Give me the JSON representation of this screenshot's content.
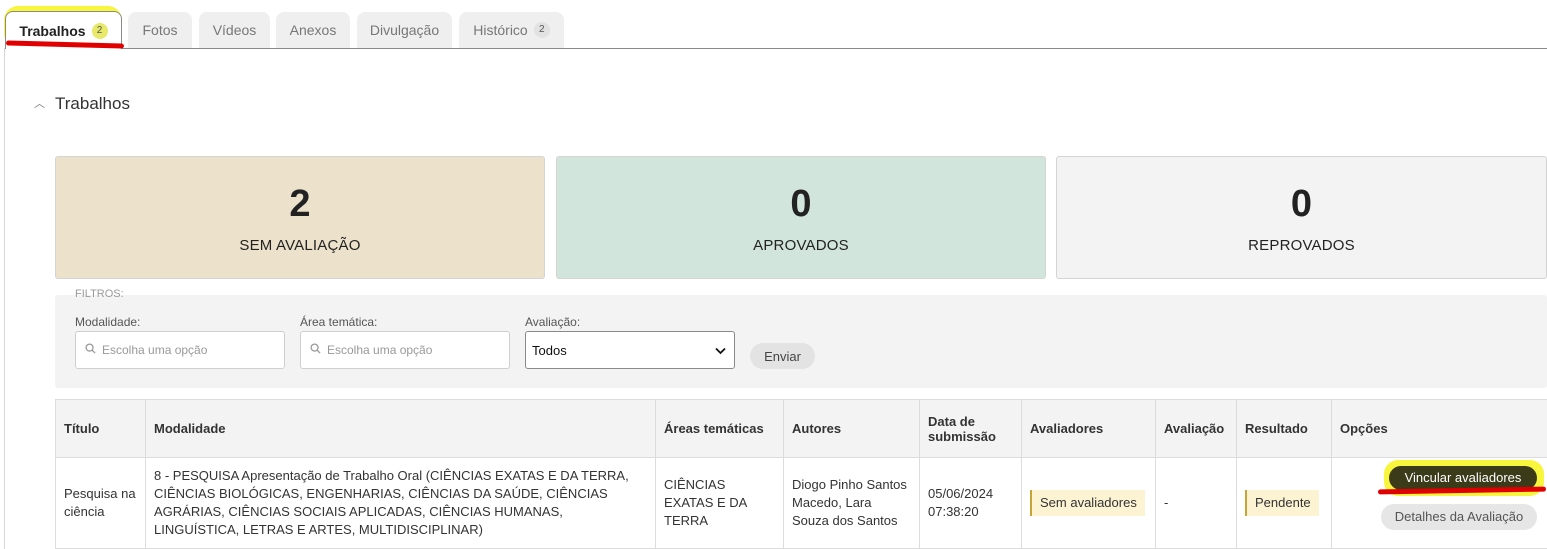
{
  "tabs": [
    {
      "label": "Trabalhos",
      "badge": "2"
    },
    {
      "label": "Fotos"
    },
    {
      "label": "Vídeos"
    },
    {
      "label": "Anexos"
    },
    {
      "label": "Divulgação"
    },
    {
      "label": "Histórico",
      "badge": "2"
    }
  ],
  "section": {
    "title": "Trabalhos"
  },
  "stats": [
    {
      "value": "2",
      "label": "SEM AVALIAÇÃO",
      "color": "#ece2cb"
    },
    {
      "value": "0",
      "label": "APROVADOS",
      "color": "#d2e5dc"
    },
    {
      "value": "0",
      "label": "REPROVADOS",
      "color": "#f3f3f3"
    }
  ],
  "filters": {
    "title": "FILTROS:",
    "modalidade": {
      "label": "Modalidade:",
      "placeholder": "Escolha uma opção"
    },
    "area": {
      "label": "Área temática:",
      "placeholder": "Escolha uma opção"
    },
    "avaliacao": {
      "label": "Avaliação:",
      "value": "Todos"
    },
    "submit": "Enviar"
  },
  "table": {
    "headers": [
      "Título",
      "Modalidade",
      "Áreas temáticas",
      "Autores",
      "Data de submissão",
      "Avaliadores",
      "Avaliação",
      "Resultado",
      "Opções"
    ],
    "rows": [
      {
        "titulo": "Pesquisa na ciência",
        "modalidade": "8 - PESQUISA Apresentação de Trabalho Oral (CIÊNCIAS EXATAS E DA TERRA, CIÊNCIAS BIOLÓGICAS, ENGENHARIAS, CIÊNCIAS DA SAÚDE, CIÊNCIAS AGRÁRIAS, CIÊNCIAS SOCIAIS APLICADAS, CIÊNCIAS HUMANAS, LINGUÍSTICA, LETRAS E ARTES, MULTIDISCIPLINAR)",
        "areas": "CIÊNCIAS EXATAS E DA TERRA",
        "autores": "Diogo Pinho Santos Macedo, Lara Souza dos Santos",
        "data": "05/06/2024 07:38:20",
        "avaliadores": "Sem avaliadores",
        "avaliacao": "-",
        "resultado": "Pendente",
        "btn_vincular": "Vincular avaliadores",
        "btn_detalhes": "Detalhes da Avaliação"
      }
    ]
  },
  "colors": {
    "highlight_yellow": "#f6f51a",
    "highlight_red": "#e00000",
    "button_dark": "#3b3a19",
    "tag_bg": "#fcf3d3"
  }
}
